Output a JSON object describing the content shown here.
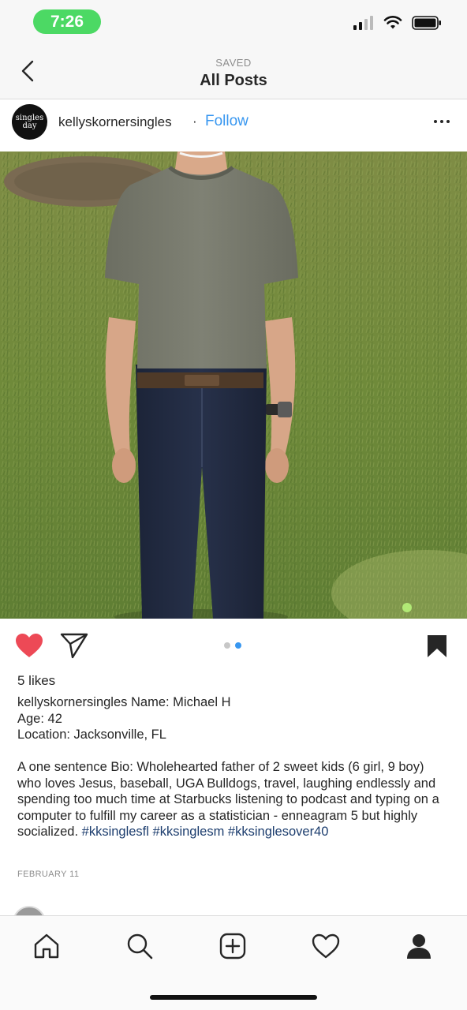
{
  "status_bar": {
    "time": "7:26",
    "icons": [
      "signal-icon",
      "wifi-icon",
      "battery-icon"
    ]
  },
  "nav": {
    "subtitle": "SAVED",
    "title": "All Posts",
    "back_icon": "chevron-left-icon"
  },
  "post": {
    "username": "kellyskornersingles",
    "separator": "·",
    "follow_label": "Follow",
    "avatar_logo_text": [
      "singles",
      "day"
    ],
    "more_icon": "more-horizontal-icon",
    "photo_alt": "Man in gray t-shirt and jeans standing on grass"
  },
  "actions": {
    "like_icon": "heart-filled-icon",
    "share_icon": "paper-plane-icon",
    "save_icon": "bookmark-filled-icon",
    "carousel_total": 2,
    "carousel_active": 2
  },
  "engagement": {
    "likes": "5 likes"
  },
  "caption": {
    "username": "kellyskornersingles",
    "line1": "Name: Michael H",
    "line2": "Age: 42",
    "line3": "Location: Jacksonville, FL",
    "bio": "A one sentence Bio: Wholehearted father of 2 sweet kids (6 girl, 9 boy) who loves Jesus, baseball, UGA Bulldogs, travel, laughing endlessly and spending too much time at Starbucks listening to podcast and typing on a computer to fulfill my career as a statistician - enneagram 5 but highly socialized.",
    "hashtags": [
      "#kksinglesfl",
      "#kksinglesm",
      "#kksinglesover40"
    ]
  },
  "date": "FEBRUARY 11",
  "tab_bar": {
    "tabs": [
      "home-icon",
      "search-icon",
      "new-post-icon",
      "activity-heart-icon",
      "profile-icon"
    ]
  },
  "colors": {
    "accent_blue": "#3897f0",
    "like_red": "#ed4956",
    "status_green": "#4cd964",
    "hashtag": "#1c3d6e"
  }
}
